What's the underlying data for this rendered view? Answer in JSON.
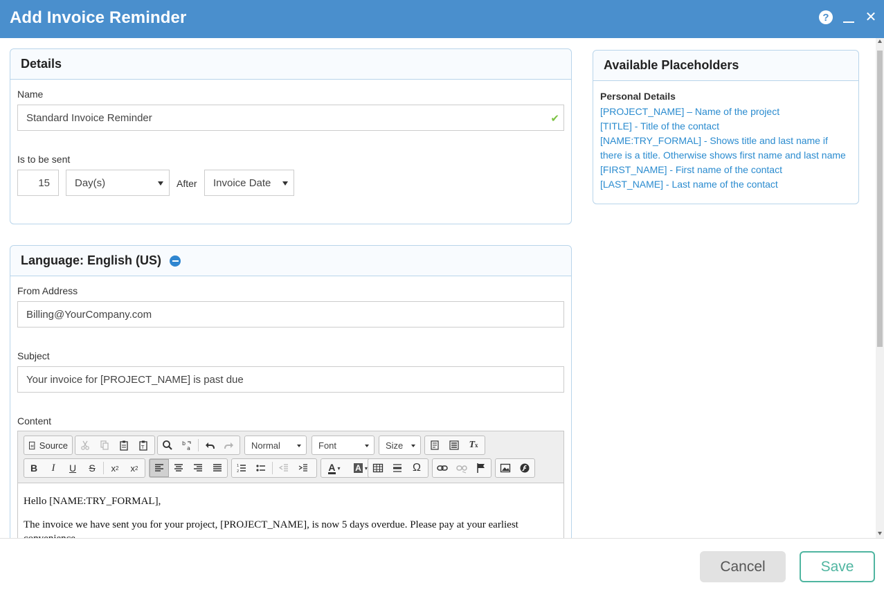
{
  "window": {
    "title": "Add Invoice Reminder"
  },
  "details": {
    "heading": "Details",
    "name_label": "Name",
    "name_value": "Standard Invoice Reminder",
    "sent_label": "Is to be sent",
    "sent_amount": "15",
    "sent_unit": "Day(s)",
    "after_label": "After",
    "after_value": "Invoice Date"
  },
  "language": {
    "heading": "Language: English (US)",
    "from_label": "From Address",
    "from_value": "Billing@YourCompany.com",
    "subject_label": "Subject",
    "subject_value": "Your invoice for [PROJECT_NAME] is past due",
    "content_label": "Content"
  },
  "editor": {
    "source_label": "Source",
    "format_value": "Normal",
    "font_value": "Font",
    "size_value": "Size",
    "body_lines": [
      "Hello [NAME:TRY_FORMAL],",
      "The invoice we have sent you for your project, [PROJECT_NAME], is now 5 days overdue. Please pay at your earliest convenience."
    ]
  },
  "placeholders": {
    "heading": "Available Placeholders",
    "section_title": "Personal Details",
    "items": [
      "[PROJECT_NAME] – Name of the project",
      "[TITLE] - Title of the contact",
      "[NAME:TRY_FORMAL] - Shows title and last name if there is a title. Otherwise shows first name and last name",
      "[FIRST_NAME] - First name of the contact",
      "[LAST_NAME] - Last name of the contact"
    ]
  },
  "footer": {
    "cancel_label": "Cancel",
    "save_label": "Save"
  },
  "colors": {
    "titlebar": "#4a8fcd",
    "link": "#2a8bcf",
    "save_accent": "#4fb5a0",
    "valid_check": "#7cc243"
  }
}
